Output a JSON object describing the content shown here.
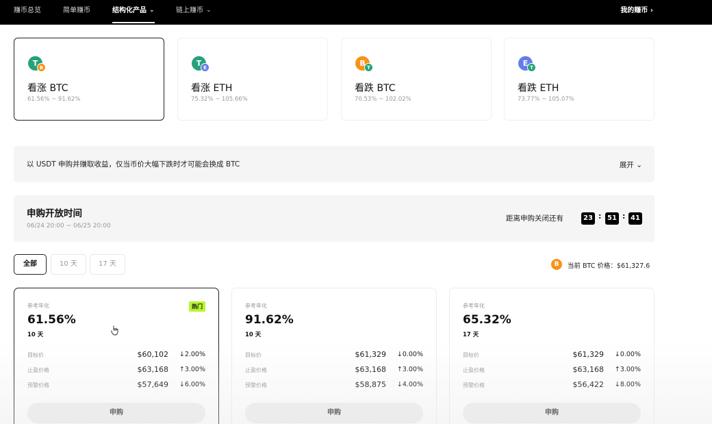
{
  "nav": {
    "items": [
      {
        "label": "赚币总览"
      },
      {
        "label": "简单赚币"
      },
      {
        "label": "结构化产品"
      },
      {
        "label": "链上赚币"
      }
    ],
    "chevron": "⌄",
    "right_label": "我的赚币 ›"
  },
  "products": [
    {
      "title": "看涨 BTC",
      "range": "61.56% ~ 91.62%",
      "main_coin": "T",
      "sub_coin": "B"
    },
    {
      "title": "看涨 ETH",
      "range": "75.32% ~ 105.66%",
      "main_coin": "T",
      "sub_coin": "E"
    },
    {
      "title": "看跌 BTC",
      "range": "70.53% ~ 102.02%",
      "main_coin": "B",
      "sub_coin": "T"
    },
    {
      "title": "看跌 ETH",
      "range": "73.77% ~ 105.07%",
      "main_coin": "E",
      "sub_coin": "T"
    }
  ],
  "info": {
    "text": "以 USDT 申购并赚取收益，仅当币价大幅下跌时才可能会换成 BTC",
    "expand": "展开 ⌄"
  },
  "subscription": {
    "title": "申购开放时间",
    "range": "06/24 20:00 ~ 06/25 20:00",
    "countdown_label": "距离申购关闭还有",
    "hours": "23",
    "minutes": "51",
    "seconds": "41",
    "sep": ":"
  },
  "filters": [
    {
      "label": "全部"
    },
    {
      "label": "10 天"
    },
    {
      "label": "17 天"
    }
  ],
  "price": {
    "coin": "B",
    "text": "当前 BTC 价格：$61,327.6"
  },
  "offers": [
    {
      "label": "参考年化",
      "hot": "热门",
      "apr": "61.56%",
      "term": "10 天",
      "rows": [
        {
          "name": "目标价",
          "value": "$60,102",
          "change": "↓2.00%"
        },
        {
          "name": "止盈价格",
          "value": "$63,168",
          "change": "↑3.00%"
        },
        {
          "name": "预警价格",
          "value": "$57,649",
          "change": "↓6.00%"
        }
      ],
      "button": "申购"
    },
    {
      "label": "参考年化",
      "apr": "91.62%",
      "term": "10 天",
      "rows": [
        {
          "name": "目标价",
          "value": "$61,329",
          "change": "↓0.00%"
        },
        {
          "name": "止盈价格",
          "value": "$63,168",
          "change": "↑3.00%"
        },
        {
          "name": "预警价格",
          "value": "$58,875",
          "change": "↓4.00%"
        }
      ],
      "button": "申购"
    },
    {
      "label": "参考年化",
      "apr": "65.32%",
      "term": "17 天",
      "rows": [
        {
          "name": "目标价",
          "value": "$61,329",
          "change": "↓0.00%"
        },
        {
          "name": "止盈价格",
          "value": "$63,168",
          "change": "↑3.00%"
        },
        {
          "name": "预警价格",
          "value": "$56,422",
          "change": "↓8.00%"
        }
      ],
      "button": "申购"
    }
  ],
  "colors": {
    "usdt": "#26a17b",
    "btc": "#f7931a",
    "eth": "#627eea",
    "hot_badge": "#b7f530"
  }
}
